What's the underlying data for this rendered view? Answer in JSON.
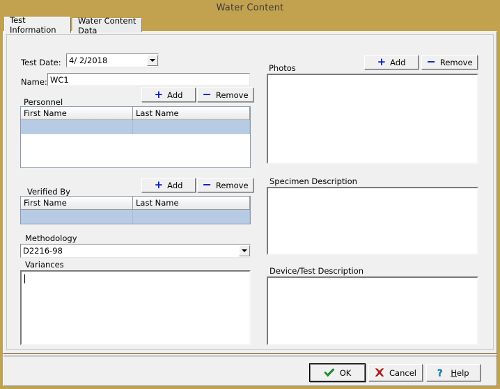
{
  "window": {
    "title": "Water Content",
    "titlebar_color": "#c3a24f",
    "panel_color": "#f0f0f0"
  },
  "tabs": [
    {
      "label": "Test Information",
      "active": true
    },
    {
      "label": "Water Content Data",
      "active": false
    }
  ],
  "form": {
    "test_date": {
      "label": "Test Date:",
      "value": "4/  2/2018",
      "dropdown_icon": "chevron-down-icon"
    },
    "name": {
      "label": "Name:",
      "value": "WC1",
      "placeholder": ""
    },
    "personnel": {
      "label": "Personnel",
      "add_label": "Add",
      "remove_label": "Remove",
      "add_icon": "plus-icon",
      "remove_icon": "minus-icon",
      "columns": [
        "First Name",
        "Last Name"
      ],
      "rows": [
        {
          "first_name": "",
          "last_name": "",
          "selected": true
        }
      ]
    },
    "verified_by": {
      "label": "Verified By",
      "add_label": "Add",
      "remove_label": "Remove",
      "add_icon": "plus-icon",
      "remove_icon": "minus-icon",
      "columns": [
        "First Name",
        "Last Name"
      ],
      "rows": [
        {
          "first_name": "",
          "last_name": "",
          "selected": true
        }
      ]
    },
    "methodology": {
      "label": "Methodology",
      "value": "D2216-98",
      "dropdown_icon": "chevron-down-icon"
    },
    "variances": {
      "label": "Variances",
      "value": "",
      "has_caret": true
    },
    "photos": {
      "label": "Photos",
      "add_label": "Add",
      "remove_label": "Remove",
      "add_icon": "plus-icon",
      "remove_icon": "minus-icon",
      "items": []
    },
    "specimen_description": {
      "label": "Specimen Description",
      "value": ""
    },
    "device_test_description": {
      "label": "Device/Test Description",
      "value": ""
    }
  },
  "footer": {
    "ok_label": "OK",
    "ok_icon": "check-icon",
    "cancel_label": "Cancel",
    "cancel_icon": "cross-icon",
    "help_label": "Help",
    "help_label_prefix": "H",
    "help_label_rest": "elp",
    "help_icon": "question-mark-icon"
  },
  "colors": {
    "accent_gold": "#c3a24f",
    "selection_blue": "#b7cbe5",
    "sign_blue": "#0018c8",
    "ok_green": "#0f8a2a",
    "cancel_red": "#c01818",
    "help_cyan": "#1a8ac8"
  }
}
